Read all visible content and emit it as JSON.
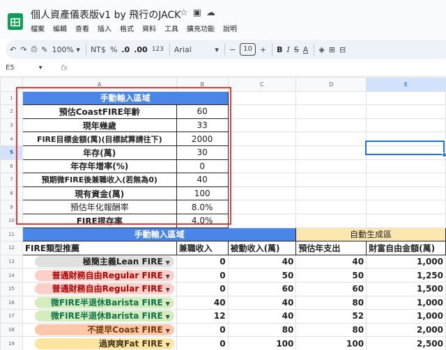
{
  "app": {
    "title": "個人資產儀表版v1 by 飛行のJACK",
    "menu": [
      "檔案",
      "編輯",
      "查看",
      "插入",
      "格式",
      "資料",
      "工具",
      "擴充功能",
      "說明"
    ]
  },
  "toolbar": {
    "zoom": "100%",
    "currency": "NT$",
    "percent": "%",
    "dec_less": ".0",
    "dec_more": ".00",
    "number_format": "123",
    "font": "Arial",
    "font_size": "10",
    "minus": "−",
    "plus": "+",
    "bold": "B",
    "italic": "I",
    "strike": "S",
    "text_color": "A"
  },
  "formula_bar": {
    "cell_ref": "E5",
    "fx": "fx"
  },
  "columns": [
    "A",
    "B",
    "C",
    "D",
    "E"
  ],
  "rows": [
    "1",
    "2",
    "3",
    "4",
    "5",
    "6",
    "7",
    "8",
    "9",
    "10",
    "11",
    "12",
    "13",
    "14",
    "15",
    "16",
    "17",
    "18",
    "19"
  ],
  "input_section": {
    "header": "手動輸入區域",
    "rows": [
      {
        "label": "預估CoastFIRE年齡",
        "value": "60"
      },
      {
        "label": "現年幾歲",
        "value": "33"
      },
      {
        "label": "FIRE目標金額(萬)(目標試算請往下)",
        "value": "2000"
      },
      {
        "label": "年存(萬)",
        "value": "30"
      },
      {
        "label": "年存年增率(%)",
        "value": "0"
      },
      {
        "label": "預期微FIRE後兼職收入(若無為0)",
        "value": "40"
      },
      {
        "label": "現有資金(萬)",
        "value": "100"
      },
      {
        "label": "預估年化報酬率",
        "value": "8.0%"
      },
      {
        "label": "FIRE提存率",
        "value": "4.0%"
      }
    ]
  },
  "fire_table": {
    "manual_header": "手動輸入區域",
    "auto_header": "自動生成區",
    "headers": [
      "FIRE類型推薦",
      "兼職收入",
      "被動收入(萬)",
      "預估年支出",
      "財富自由金額(萬)"
    ],
    "rows": [
      {
        "type": "極簡主義Lean FIRE",
        "part_time": "0",
        "passive": "40",
        "spend": "40",
        "target": "1,000",
        "chip_bg": "#e0e0e0",
        "chip_fg": "#1f1f1f"
      },
      {
        "type": "普通財務自由Regular FIRE",
        "part_time": "0",
        "passive": "50",
        "spend": "50",
        "target": "1,250",
        "chip_bg": "#ffcfc9",
        "chip_fg": "#b10202"
      },
      {
        "type": "普通財務自由Regular FIRE",
        "part_time": "0",
        "passive": "60",
        "spend": "60",
        "target": "1,500",
        "chip_bg": "#ffcfc9",
        "chip_fg": "#b10202"
      },
      {
        "type": "微FIRE半退休Barista FIRE",
        "part_time": "40",
        "passive": "40",
        "spend": "80",
        "target": "1,000",
        "chip_bg": "#d4edbc",
        "chip_fg": "#11734b"
      },
      {
        "type": "微FIRE半退休Barista FIRE",
        "part_time": "12",
        "passive": "40",
        "spend": "52",
        "target": "1,000",
        "chip_bg": "#d4edbc",
        "chip_fg": "#11734b"
      },
      {
        "type": "不提早Coast FIRE",
        "part_time": "0",
        "passive": "80",
        "spend": "80",
        "target": "2,000",
        "chip_bg": "#ffc8aa",
        "chip_fg": "#753800"
      },
      {
        "type": "過爽爽Fat FIRE",
        "part_time": "0",
        "passive": "100",
        "spend": "100",
        "target": "2,500",
        "chip_bg": "#ffe5a0",
        "chip_fg": "#473821"
      }
    ]
  }
}
